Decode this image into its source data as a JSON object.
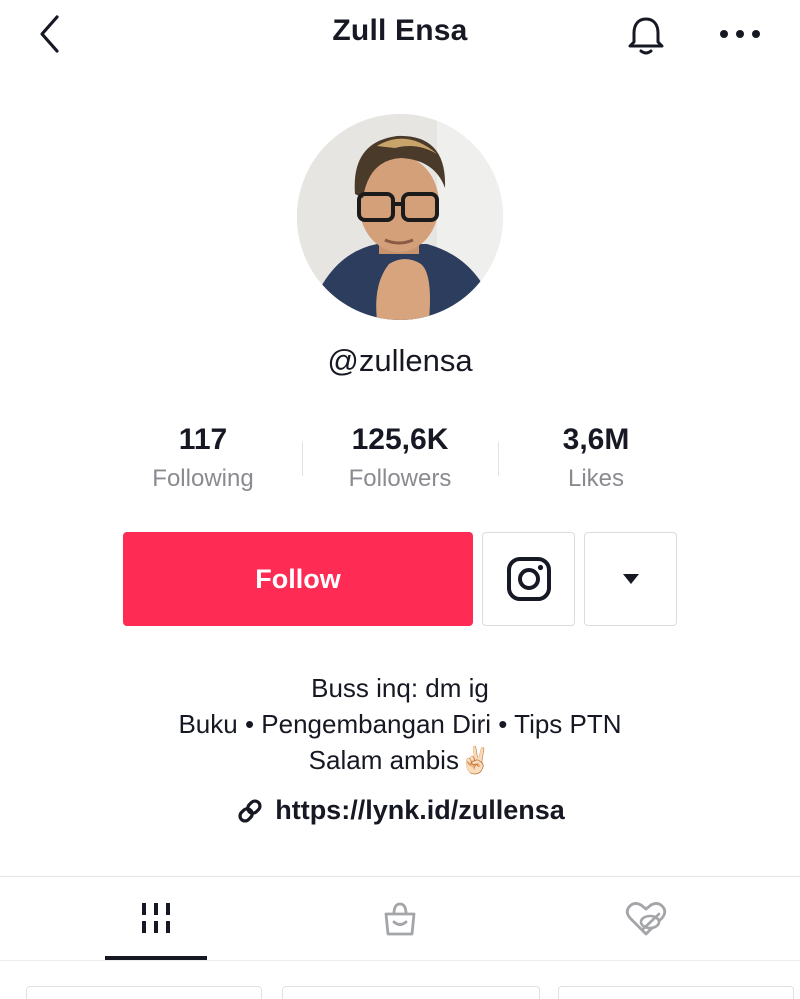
{
  "header": {
    "title": "Zull Ensa"
  },
  "profile": {
    "username": "@zullensa"
  },
  "stats": [
    {
      "value": "117",
      "label": "Following"
    },
    {
      "value": "125,6K",
      "label": "Followers"
    },
    {
      "value": "3,6M",
      "label": "Likes"
    }
  ],
  "actions": {
    "follow_label": "Follow"
  },
  "bio": {
    "line1": "Buss inq: dm ig",
    "line2": "Buku • Pengembangan Diri • Tips PTN",
    "line3": "Salam ambis",
    "line3_emoji": "✌🏻"
  },
  "link": {
    "url": "https://lynk.id/zullensa"
  },
  "tabs": [
    {
      "icon": "videos-grid-icon",
      "active": true
    },
    {
      "icon": "shopping-bag-icon",
      "active": false
    },
    {
      "icon": "hidden-likes-icon",
      "active": false
    }
  ],
  "colors": {
    "accent": "#fe2c55",
    "text": "#161823",
    "secondary_text": "#8a8b91",
    "border": "#dcdcde"
  }
}
